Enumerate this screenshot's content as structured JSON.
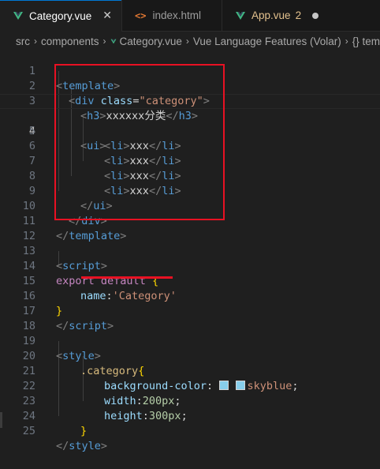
{
  "tabs": [
    {
      "label": "Category.vue",
      "icon": "vue-file-icon",
      "active": true,
      "close": "✕"
    },
    {
      "label": "index.html",
      "icon": "html-file-icon",
      "active": false
    },
    {
      "label": "App.vue",
      "icon": "vue-file-icon",
      "active": false,
      "badge": "2"
    }
  ],
  "breadcrumb": {
    "items": [
      "src",
      "components",
      "Category.vue",
      "Vue Language Features (Volar)",
      "{} tem"
    ]
  },
  "editor": {
    "current_line": "4",
    "lines": [
      {
        "n": "1"
      },
      {
        "n": "2"
      },
      {
        "n": "3"
      },
      {
        "n": "4"
      },
      {
        "n": "5"
      },
      {
        "n": "6"
      },
      {
        "n": "7"
      },
      {
        "n": "8"
      },
      {
        "n": "9"
      },
      {
        "n": "10"
      },
      {
        "n": "11"
      },
      {
        "n": "12"
      },
      {
        "n": "13"
      },
      {
        "n": "14"
      },
      {
        "n": "15"
      },
      {
        "n": "16"
      },
      {
        "n": "17"
      },
      {
        "n": "18"
      },
      {
        "n": "19"
      },
      {
        "n": "20"
      },
      {
        "n": "21"
      },
      {
        "n": "22"
      },
      {
        "n": "23"
      },
      {
        "n": "24"
      },
      {
        "n": "25"
      }
    ],
    "text": {
      "template": "template",
      "div": "div",
      "class_attr": "class",
      "class_val": "\"category\"",
      "h3": "h3",
      "h3_text": "xxxxxx分类",
      "ui": "ui",
      "li": "li",
      "li_text": "xxx",
      "script": "script",
      "export": "export",
      "default": "default",
      "name_key": "name",
      "name_val": "'Category'",
      "style": "style",
      "selector": ".category",
      "bg_prop": "background-color",
      "bg_val": "skyblue",
      "width_prop": "width",
      "width_val": "200px",
      "height_prop": "height",
      "height_val": "300px"
    }
  },
  "colors": {
    "annotation": "#e81123",
    "swatch": "#87ceeb",
    "tab_accent": "#0078d4"
  }
}
